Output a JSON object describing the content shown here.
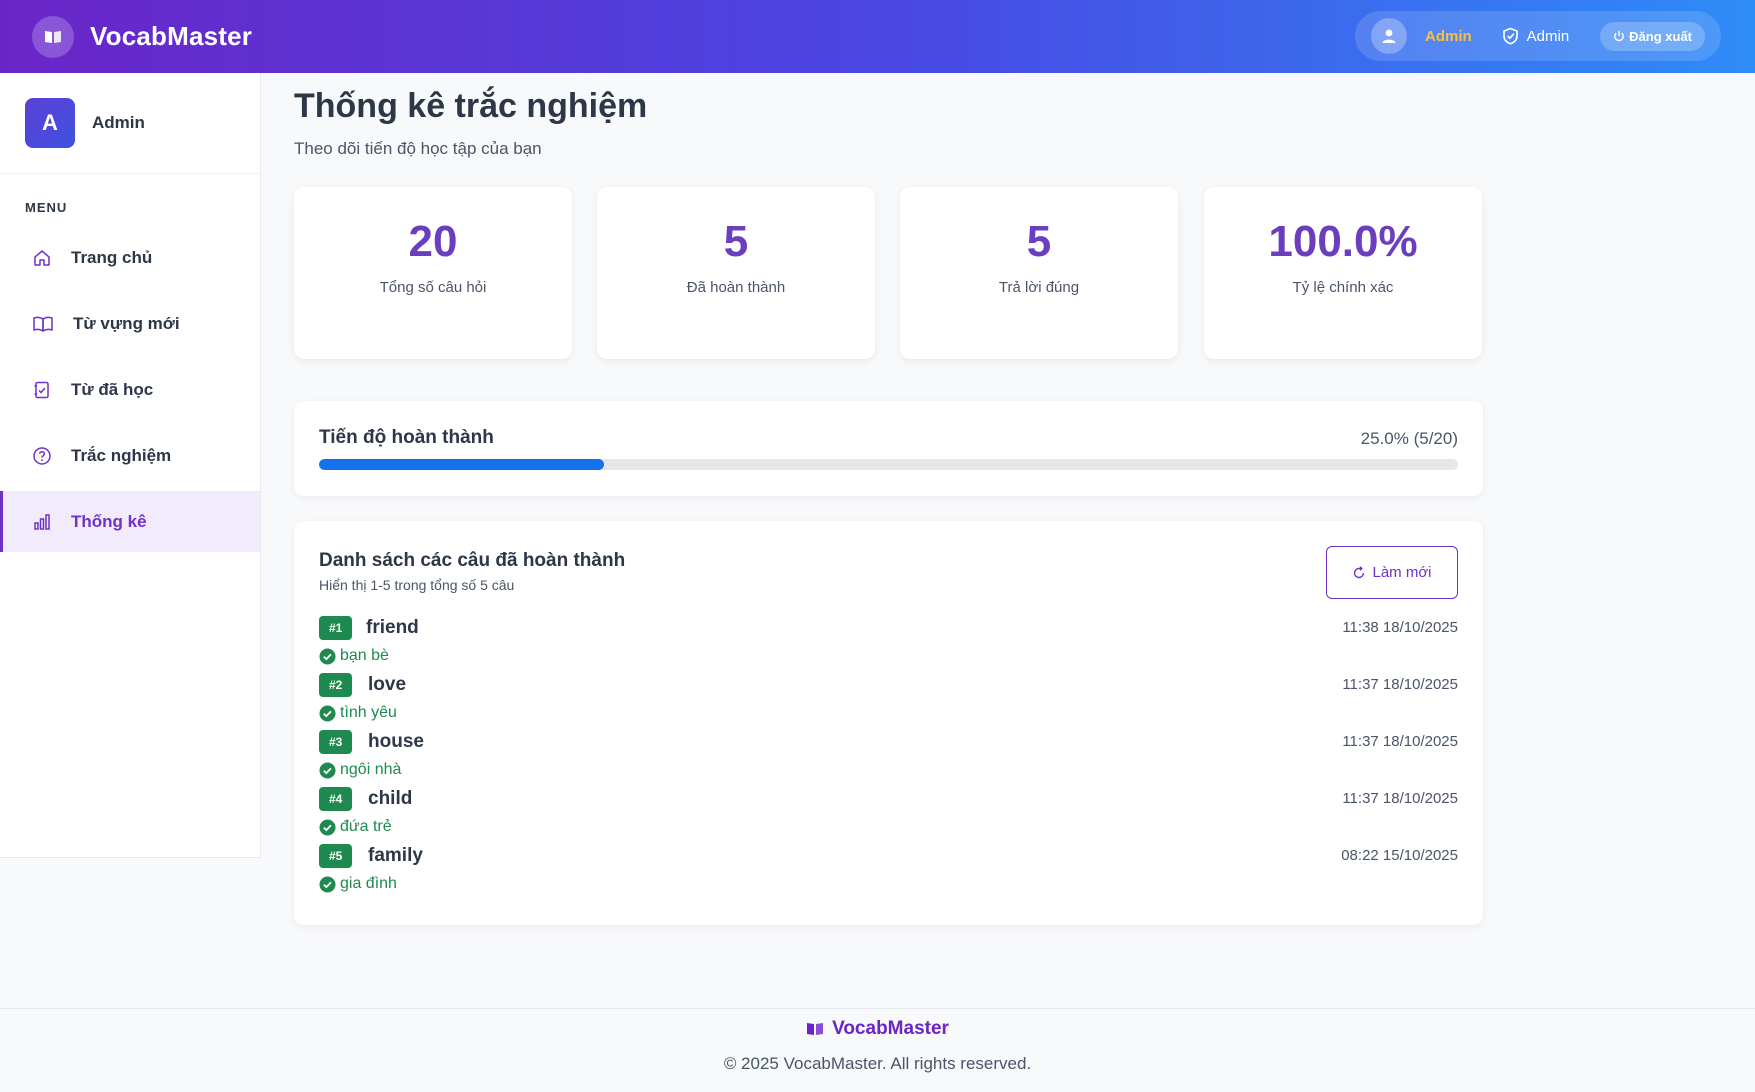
{
  "app": {
    "name": "VocabMaster"
  },
  "header": {
    "user_name": "Admin",
    "role": "Admin",
    "logout_label": "Đăng xuất"
  },
  "sidebar": {
    "avatar_letter": "A",
    "user_name": "Admin",
    "menu_title": "MENU",
    "items": [
      {
        "label": "Trang chủ",
        "icon": "home-icon",
        "active": false
      },
      {
        "label": "Từ vựng mới",
        "icon": "book-open-icon",
        "active": false
      },
      {
        "label": "Từ đã học",
        "icon": "checklist-icon",
        "active": false
      },
      {
        "label": "Trắc nghiệm",
        "icon": "question-circle-icon",
        "active": false
      },
      {
        "label": "Thống kê",
        "icon": "bar-chart-icon",
        "active": true
      }
    ]
  },
  "page": {
    "title": "Thống kê trắc nghiệm",
    "subtitle": "Theo dõi tiến độ học tập của bạn"
  },
  "stats": [
    {
      "value": "20",
      "label": "Tổng số câu hỏi"
    },
    {
      "value": "5",
      "label": "Đã hoàn thành"
    },
    {
      "value": "5",
      "label": "Trả lời đúng"
    },
    {
      "value": "100.0%",
      "label": "Tỷ lệ chính xác"
    }
  ],
  "progress": {
    "title": "Tiến độ hoàn thành",
    "value_text": "25.0% (5/20)",
    "percent": 25
  },
  "completed_list": {
    "title": "Danh sách các câu đã hoàn thành",
    "subtitle": "Hiển thị 1-5 trong tổng số 5 câu",
    "refresh_label": "Làm mới",
    "items": [
      {
        "badge": "#1",
        "word": "friend",
        "meaning": "bạn bè",
        "time": "11:38 18/10/2025"
      },
      {
        "badge": "#2",
        "word": "love",
        "meaning": "tình yêu",
        "time": "11:37 18/10/2025"
      },
      {
        "badge": "#3",
        "word": "house",
        "meaning": "ngôi nhà",
        "time": "11:37 18/10/2025"
      },
      {
        "badge": "#4",
        "word": "child",
        "meaning": "đứa trẻ",
        "time": "11:37 18/10/2025"
      },
      {
        "badge": "#5",
        "word": "family",
        "meaning": "gia đình",
        "time": "08:22 15/10/2025"
      }
    ]
  },
  "footer": {
    "brand": "VocabMaster",
    "copyright": "© 2025 VocabMaster. All rights reserved."
  },
  "colors": {
    "accent": "#6f31c7",
    "success": "#1e8a4f",
    "progress": "#1372ec",
    "header_start": "#6a25c8",
    "header_end": "#2e8cf8"
  }
}
